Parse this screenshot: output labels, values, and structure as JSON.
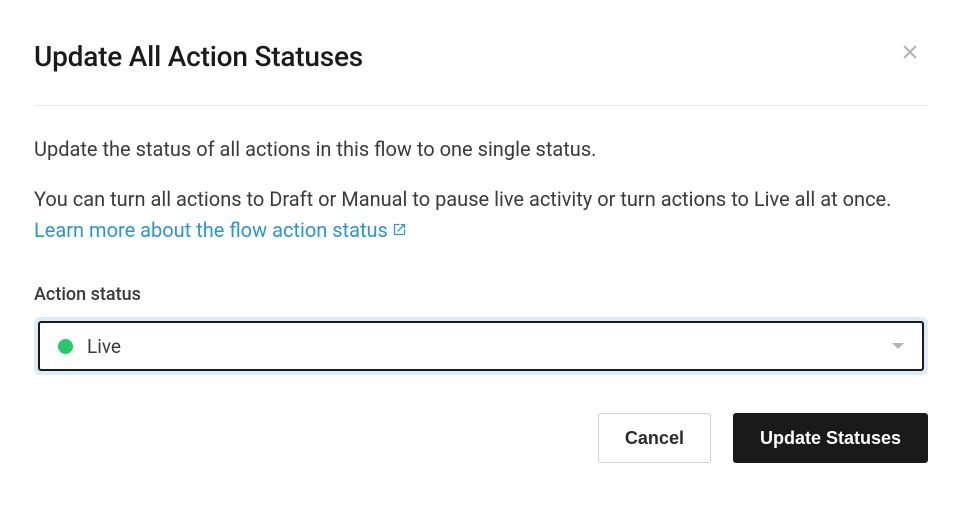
{
  "modal": {
    "title": "Update All Action Statuses",
    "description1": "Update the status of all actions in this flow to one single status.",
    "description2_part1": "You can turn all actions to Draft or Manual to pause live activity or turn actions to Live all at once. ",
    "learn_more_text": "Learn more about the flow action status",
    "field_label": "Action status",
    "selected_status": "Live",
    "status_color": "#2bc76b",
    "cancel_label": "Cancel",
    "submit_label": "Update Statuses"
  }
}
